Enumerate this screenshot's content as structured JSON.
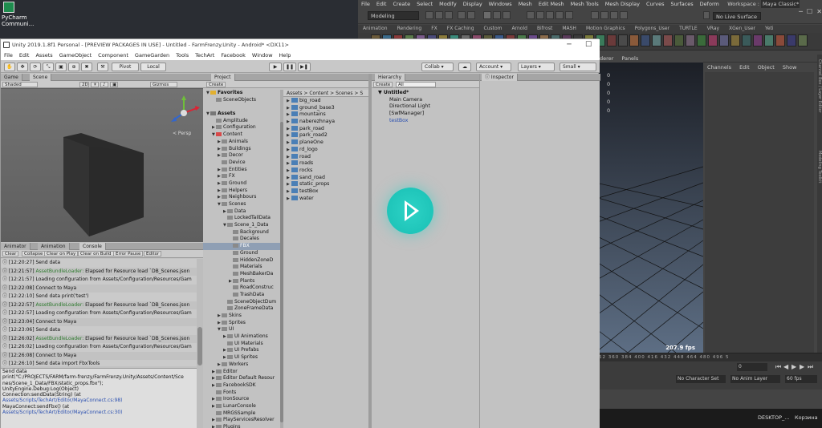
{
  "desktop": {
    "pycharm": {
      "line1": "PyCharm",
      "line2": "Communi..."
    }
  },
  "maya": {
    "menus": [
      "File",
      "Edit",
      "Create",
      "Select",
      "Modify",
      "Display",
      "Windows",
      "Mesh",
      "Edit Mesh",
      "Mesh Tools",
      "Mesh Display",
      "Curves",
      "Surfaces",
      "Deform"
    ],
    "workspace_label": "Workspace :",
    "workspace_value": "Maya Classic*",
    "mode": "Modeling",
    "no_live_surface": "No Live Surface",
    "shelf_tabs": [
      "Animation",
      "Rendering",
      "FX",
      "FX Caching",
      "Custom",
      "Arnold",
      "Bifrost",
      "MASH",
      "Motion Graphics",
      "Polygons_User",
      "TURTLE",
      "VRay",
      "XGen_User",
      "Yeti"
    ],
    "panel_menus": [
      "derer",
      "Panels"
    ],
    "viewport_numbers": [
      "0",
      "0",
      "0",
      "0",
      "0"
    ],
    "fps": "207.9 fps",
    "channelbox_menus": [
      "Channels",
      "Edit",
      "Object",
      "Show"
    ],
    "side_tabs": [
      "Channel Box / Layer Editor",
      "Modeling Toolkit"
    ],
    "ruler": "52  360  384  400 416  432 448  464  480  496  5",
    "current_frame": "0",
    "no_character_set": "No Character Set",
    "no_anim_layer": "No Anim Layer",
    "fps_setting": "60 fps",
    "taskbar": {
      "desktop": "DESKTOP_...",
      "recycle": "Корзина"
    },
    "colors": {
      "bg": "#444444",
      "viewport_top": "#1c1f26",
      "viewport_bottom": "#5d6e84"
    }
  },
  "unity": {
    "title": "Unity 2019.1.8f1 Personal - [PREVIEW PACKAGES IN USE] - Untitled - FarmFrenzy.Unity - Android* <DX11>",
    "menus": [
      "File",
      "Edit",
      "Assets",
      "GameObject",
      "Component",
      "GameGarden",
      "Tools",
      "TechArt",
      "Facebook",
      "Window",
      "Help"
    ],
    "toolbar": {
      "pivot": "Pivot",
      "local": "Local",
      "collab": "Collab",
      "account": "Account",
      "layers": "Layers",
      "layout": "Small"
    },
    "scene_panel": {
      "tabs": [
        "Game",
        "Scene"
      ],
      "shading": "Shaded",
      "mode_2d": "2D",
      "gizmos": "Gizmos",
      "persp": "< Persp"
    },
    "console_panel": {
      "tabs": [
        "Animator",
        "Animation",
        "Console"
      ],
      "buttons": [
        "Clear",
        "Collapse",
        "Clear on Play",
        "Clear on Build",
        "Error Pause",
        "Editor"
      ],
      "logs": [
        {
          "time": "[12:20:27]",
          "prefix": "",
          "text": "Send data"
        },
        {
          "time": "[12:21:57]",
          "prefix": "AssetBundleLoader:",
          "text": " Elapsed for Resource load `DB_Scenes.json"
        },
        {
          "time": "[12:21:57]",
          "prefix": "",
          "text": "Loading configuration from Assets/Configuration/Resources/Gam"
        },
        {
          "time": "[12:22:08]",
          "prefix": "",
          "text": "Connect to Maya"
        },
        {
          "time": "[12:22:10]",
          "prefix": "",
          "text": "Send data print('test')"
        },
        {
          "time": "[12:22:57]",
          "prefix": "AssetBundleLoader:",
          "text": " Elapsed for Resource load `DB_Scenes.json"
        },
        {
          "time": "[12:22:57]",
          "prefix": "",
          "text": "Loading configuration from Assets/Configuration/Resources/Gam"
        },
        {
          "time": "[12:23:04]",
          "prefix": "",
          "text": "Connect to Maya"
        },
        {
          "time": "[12:23:06]",
          "prefix": "",
          "text": "Send data"
        },
        {
          "time": "[12:26:02]",
          "prefix": "AssetBundleLoader:",
          "text": " Elapsed for Resource load `DB_Scenes.json"
        },
        {
          "time": "[12:26:02]",
          "prefix": "",
          "text": "Loading configuration from Assets/Configuration/Resources/Gam"
        },
        {
          "time": "[12:26:08]",
          "prefix": "",
          "text": "Connect to Maya"
        },
        {
          "time": "[12:26:10]",
          "prefix": "",
          "text": "Send data import FbxTools"
        },
        {
          "time": "[12:26:54]",
          "prefix": "AssetBundleLoader:",
          "text": " Elapsed for Resource load `DB_Scenes.json"
        }
      ],
      "detail": [
        {
          "text": "Send data",
          "link": false
        },
        {
          "text": "print(\"C:/PROJECTS/FARM/farm-frenzy/FarmFrenzy.Unity/Assets/Content/Sce",
          "link": false
        },
        {
          "text": "nes/Scene_1_Data/FBX/static_props.fbx\");",
          "link": false
        },
        {
          "text": "UnityEngine.Debug:Log(Object)",
          "link": false
        },
        {
          "text": "Connection:sendData(String) (at",
          "link": false
        },
        {
          "text": "Assets/Scripts/TechArt/Editor/MayaConnect.cs:98)",
          "link": true
        },
        {
          "text": "MayaConnect:sendFbx() (at",
          "link": false
        },
        {
          "text": "Assets/Scripts/TechArt/Editor/MayaConnect.cs:30)",
          "link": true
        }
      ]
    },
    "project_panel": {
      "tab": "Project",
      "create": "Create",
      "breadcrumb": "Assets > Content > Scenes > S",
      "favorites_label": "Favorites",
      "tree": [
        {
          "label": "Favorites",
          "depth": 0,
          "arrow": "▼",
          "sel": false,
          "bold": true
        },
        {
          "label": "SceneObjects",
          "depth": 1,
          "arrow": "",
          "sel": false
        },
        {
          "label": "",
          "depth": 0,
          "arrow": "",
          "sel": false
        },
        {
          "label": "Assets",
          "depth": 0,
          "arrow": "▼",
          "sel": false,
          "bold": true
        },
        {
          "label": "Amplitude",
          "depth": 1,
          "arrow": "",
          "sel": false
        },
        {
          "label": "Configuration",
          "depth": 1,
          "arrow": "▶",
          "sel": false
        },
        {
          "label": "Content",
          "depth": 1,
          "arrow": "▼",
          "sel": false
        },
        {
          "label": "Animals",
          "depth": 2,
          "arrow": "▶",
          "sel": false
        },
        {
          "label": "Buildings",
          "depth": 2,
          "arrow": "▶",
          "sel": false
        },
        {
          "label": "Decor",
          "depth": 2,
          "arrow": "▶",
          "sel": false
        },
        {
          "label": "Device",
          "depth": 2,
          "arrow": "",
          "sel": false
        },
        {
          "label": "Entities",
          "depth": 2,
          "arrow": "▶",
          "sel": false
        },
        {
          "label": "FX",
          "depth": 2,
          "arrow": "▶",
          "sel": false
        },
        {
          "label": "Ground",
          "depth": 2,
          "arrow": "▶",
          "sel": false
        },
        {
          "label": "Helpers",
          "depth": 2,
          "arrow": "▶",
          "sel": false
        },
        {
          "label": "Neighbours",
          "depth": 2,
          "arrow": "▶",
          "sel": false
        },
        {
          "label": "Scenes",
          "depth": 2,
          "arrow": "▼",
          "sel": false
        },
        {
          "label": "Data",
          "depth": 3,
          "arrow": "▶",
          "sel": false
        },
        {
          "label": "LockedTailData",
          "depth": 3,
          "arrow": "",
          "sel": false
        },
        {
          "label": "Scene_1_Data",
          "depth": 3,
          "arrow": "▼",
          "sel": false
        },
        {
          "label": "Background",
          "depth": 4,
          "arrow": "",
          "sel": false
        },
        {
          "label": "Decales",
          "depth": 4,
          "arrow": "",
          "sel": false
        },
        {
          "label": "FBX",
          "depth": 4,
          "arrow": "",
          "sel": true
        },
        {
          "label": "Ground",
          "depth": 4,
          "arrow": "",
          "sel": false
        },
        {
          "label": "HiddenZoneD",
          "depth": 4,
          "arrow": "",
          "sel": false
        },
        {
          "label": "Materials",
          "depth": 4,
          "arrow": "",
          "sel": false
        },
        {
          "label": "MeshBakerDa",
          "depth": 4,
          "arrow": "",
          "sel": false
        },
        {
          "label": "Plants",
          "depth": 4,
          "arrow": "▶",
          "sel": false
        },
        {
          "label": "RoadConstruc",
          "depth": 4,
          "arrow": "",
          "sel": false
        },
        {
          "label": "TrashData",
          "depth": 4,
          "arrow": "",
          "sel": false
        },
        {
          "label": "SceneObjectDum",
          "depth": 3,
          "arrow": "",
          "sel": false
        },
        {
          "label": "ZoneFrameData",
          "depth": 3,
          "arrow": "",
          "sel": false
        },
        {
          "label": "Skins",
          "depth": 2,
          "arrow": "▶",
          "sel": false
        },
        {
          "label": "Sprites",
          "depth": 2,
          "arrow": "▶",
          "sel": false
        },
        {
          "label": "UI",
          "depth": 2,
          "arrow": "▼",
          "sel": false
        },
        {
          "label": "UI Animations",
          "depth": 3,
          "arrow": "▶",
          "sel": false
        },
        {
          "label": "UI Materials",
          "depth": 3,
          "arrow": "",
          "sel": false
        },
        {
          "label": "UI Prefabs",
          "depth": 3,
          "arrow": "▶",
          "sel": false
        },
        {
          "label": "UI Sprites",
          "depth": 3,
          "arrow": "▶",
          "sel": false
        },
        {
          "label": "Workers",
          "depth": 2,
          "arrow": "▶",
          "sel": false
        },
        {
          "label": "Editor",
          "depth": 1,
          "arrow": "▶",
          "sel": false
        },
        {
          "label": "Editor Default Resour",
          "depth": 1,
          "arrow": "▶",
          "sel": false
        },
        {
          "label": "FacebookSDK",
          "depth": 1,
          "arrow": "▶",
          "sel": false
        },
        {
          "label": "Fonts",
          "depth": 1,
          "arrow": "",
          "sel": false
        },
        {
          "label": "IronSource",
          "depth": 1,
          "arrow": "▶",
          "sel": false
        },
        {
          "label": "LunarConsole",
          "depth": 1,
          "arrow": "▶",
          "sel": false
        },
        {
          "label": "MRGSSample",
          "depth": 1,
          "arrow": "",
          "sel": false
        },
        {
          "label": "PlayServicesResolver",
          "depth": 1,
          "arrow": "▶",
          "sel": false
        },
        {
          "label": "Plugins",
          "depth": 1,
          "arrow": "▶",
          "sel": false
        }
      ],
      "assets": [
        "big_road",
        "ground_base3",
        "mountains",
        "naberezhnaya",
        "park_road",
        "park_road2",
        "planeOne",
        "rd_logo",
        "road",
        "roads",
        "rocks",
        "sand_road",
        "static_props",
        "testBox",
        "water"
      ]
    },
    "hierarchy_panel": {
      "tab": "Hierarchy",
      "create": "Create",
      "search_placeholder": "All",
      "scene": "Untitled*",
      "items": [
        "Main Camera",
        "Directional Light",
        "[SwfManager]",
        "testBox"
      ]
    },
    "inspector_panel": {
      "tab": "Inspector"
    }
  },
  "overlay": {
    "play_color": "#22c8bc"
  }
}
